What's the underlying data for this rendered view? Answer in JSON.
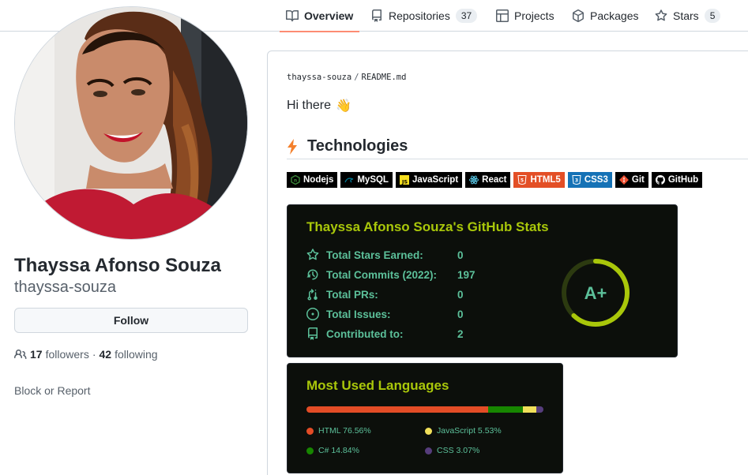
{
  "nav": {
    "tabs": [
      {
        "label": "Overview",
        "icon": "book-icon",
        "active": true
      },
      {
        "label": "Repositories",
        "icon": "repo-icon",
        "count": "37"
      },
      {
        "label": "Projects",
        "icon": "table-icon"
      },
      {
        "label": "Packages",
        "icon": "package-icon"
      },
      {
        "label": "Stars",
        "icon": "star-icon",
        "count": "5"
      }
    ]
  },
  "profile": {
    "full_name": "Thayssa Afonso Souza",
    "login": "thayssa-souza",
    "follow_label": "Follow",
    "followers_count": "17",
    "followers_label": "followers",
    "separator": "·",
    "following_count": "42",
    "following_label": "following",
    "block_label": "Block or Report"
  },
  "readme": {
    "owner": "thayssa-souza",
    "sep": "/",
    "file": "README.md",
    "greeting": "Hi there",
    "greeting_emoji": "👋",
    "tech_heading": "Technologies",
    "tech_icon": "lightning-icon",
    "badges": [
      {
        "label": "Nodejs",
        "bg": "#000000",
        "icon_color": "#3c873a"
      },
      {
        "label": "MySQL",
        "bg": "#000000",
        "icon_color": "#00758f"
      },
      {
        "label": "JavaScript",
        "bg": "#000000",
        "icon_color": "#f7df1e"
      },
      {
        "label": "React",
        "bg": "#000000",
        "icon_color": "#61dafb"
      },
      {
        "label": "HTML5",
        "bg": "#e34f26",
        "icon_color": "#ffffff"
      },
      {
        "label": "CSS3",
        "bg": "#1572b6",
        "icon_color": "#ffffff"
      },
      {
        "label": "Git",
        "bg": "#000000",
        "icon_color": "#f05032"
      },
      {
        "label": "GitHub",
        "bg": "#000000",
        "icon_color": "#ffffff"
      }
    ]
  },
  "stats": {
    "title": "Thayssa Afonso Souza's GitHub Stats",
    "rows": [
      {
        "label": "Total Stars Earned:",
        "value": "0",
        "icon": "star-icon"
      },
      {
        "label": "Total Commits (2022):",
        "value": "197",
        "icon": "history-icon"
      },
      {
        "label": "Total PRs:",
        "value": "0",
        "icon": "pull-request-icon"
      },
      {
        "label": "Total Issues:",
        "value": "0",
        "icon": "issue-icon"
      },
      {
        "label": "Contributed to:",
        "value": "2",
        "icon": "repo-icon"
      }
    ],
    "rank": "A+",
    "rank_progress": 0.62,
    "colors": {
      "title": "#a9c70a",
      "text": "#5cc09a",
      "bg": "#0c0f0b",
      "ring": "#a9c70a"
    }
  },
  "languages": {
    "title": "Most Used Languages",
    "items": [
      {
        "name": "HTML",
        "percent": 76.56,
        "label": "HTML 76.56%",
        "color": "#e34c26"
      },
      {
        "name": "C#",
        "percent": 14.84,
        "label": "C# 14.84%",
        "color": "#178600"
      },
      {
        "name": "JavaScript",
        "percent": 5.53,
        "label": "JavaScript 5.53%",
        "color": "#f1e05a"
      },
      {
        "name": "CSS",
        "percent": 3.07,
        "label": "CSS 3.07%",
        "color": "#563d7c"
      }
    ]
  }
}
